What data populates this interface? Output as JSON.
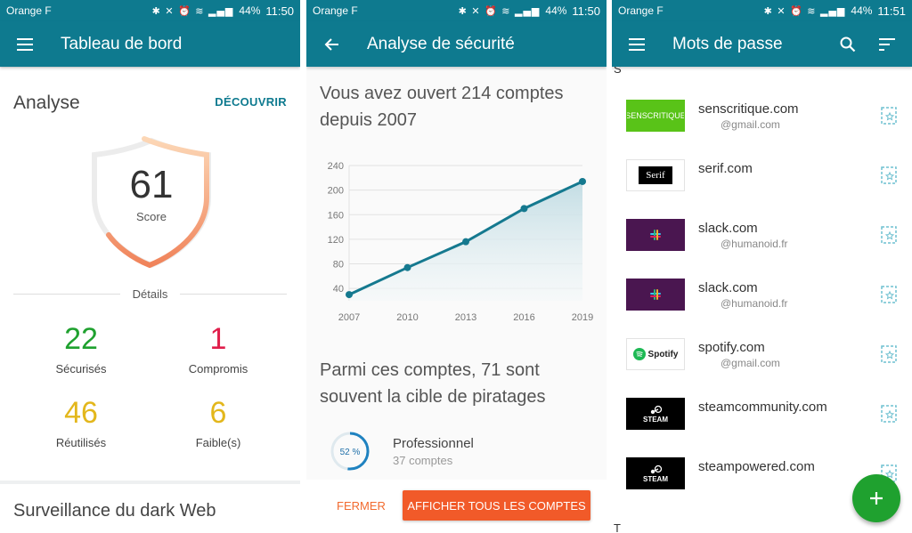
{
  "colors": {
    "primary": "#0e7a8f",
    "green": "#1fa12f",
    "red": "#e01e4b",
    "yellow": "#e3b71c",
    "orange": "#f15a29"
  },
  "status": [
    {
      "carrier": "Orange F",
      "battery": "44%",
      "time": "11:50"
    },
    {
      "carrier": "Orange F",
      "battery": "44%",
      "time": "11:50"
    },
    {
      "carrier": "Orange F",
      "battery": "44%",
      "time": "11:51"
    }
  ],
  "dashboard": {
    "title": "Tableau de bord",
    "analyse_title": "Analyse",
    "discover": "DÉCOUVRIR",
    "score": "61",
    "score_label": "Score",
    "details": "Détails",
    "stats": [
      {
        "value": "22",
        "label": "Sécurisés"
      },
      {
        "value": "1",
        "label": "Compromis"
      },
      {
        "value": "46",
        "label": "Réutilisés"
      },
      {
        "value": "6",
        "label": "Faible(s)"
      }
    ],
    "dark_web": "Surveillance du dark Web"
  },
  "security": {
    "title": "Analyse de sécurité",
    "headline": "Vous avez ouvert 214 comptes depuis 2007",
    "subheadline": "Parmi ces comptes, 71 sont souvent la cible de piratages",
    "professional": {
      "percent": "52 %",
      "percent_value": 52,
      "title": "Professionnel",
      "subtitle": "37 comptes"
    },
    "close": "FERMER",
    "show_all": "AFFICHER TOUS LES COMPTES"
  },
  "chart_data": {
    "type": "area",
    "x": [
      2007,
      2010,
      2013,
      2016,
      2019
    ],
    "values": [
      30,
      74,
      116,
      170,
      214
    ],
    "xticks": [
      "2007",
      "2010",
      "2013",
      "2016",
      "2019"
    ],
    "yticks": [
      "40",
      "80",
      "120",
      "160",
      "200",
      "240"
    ],
    "ylim": [
      20,
      240
    ],
    "xlim": [
      2007,
      2019
    ],
    "grid": true
  },
  "passwords": {
    "title": "Mots de passe",
    "sections": [
      "S",
      "T"
    ],
    "items": [
      {
        "site": "senscritique.com",
        "email": "@gmail.com",
        "logo_text": "SENSCRITIQUE",
        "logo_bg": "#59c318"
      },
      {
        "site": "serif.com",
        "email": "",
        "logo_text": "Serif",
        "logo_bg": "#ffffff"
      },
      {
        "site": "slack.com",
        "email": "@humanoid.fr",
        "logo_text": "",
        "logo_bg": "#4a1650"
      },
      {
        "site": "slack.com",
        "email": "@humanoid.fr",
        "logo_text": "",
        "logo_bg": "#4a1650"
      },
      {
        "site": "spotify.com",
        "email": "@gmail.com",
        "logo_text": "Spotify",
        "logo_bg": "#ffffff"
      },
      {
        "site": "steamcommunity.com",
        "email": "",
        "logo_text": "STEAM",
        "logo_bg": "#000000"
      },
      {
        "site": "steampowered.com",
        "email": "",
        "logo_text": "STEAM",
        "logo_bg": "#000000"
      }
    ]
  }
}
